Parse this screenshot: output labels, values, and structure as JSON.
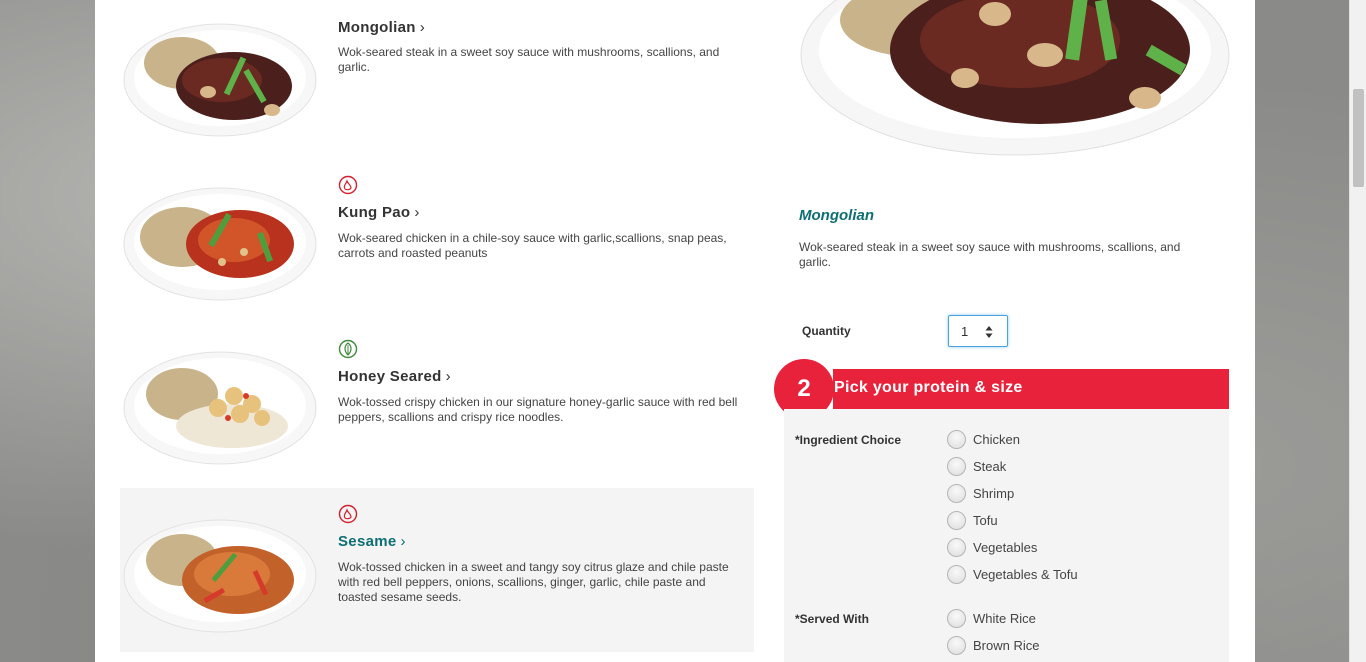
{
  "menu_items": [
    {
      "name": "Mongolian",
      "description": "Wok-seared steak in a sweet soy sauce with mushrooms, scallions, and garlic.",
      "badge": null,
      "selected": false
    },
    {
      "name": "Kung Pao",
      "description": "Wok-seared chicken in a chile-soy sauce with garlic,scallions, snap peas, carrots and roasted peanuts",
      "badge": "spicy-icon",
      "selected": false
    },
    {
      "name": "Honey Seared",
      "description": "Wok-tossed crispy chicken in our signature honey-garlic sauce with red bell peppers, scallions and crispy rice noodles.",
      "badge": "vegetarian-icon",
      "selected": false
    },
    {
      "name": "Sesame",
      "description": "Wok-tossed chicken in a sweet and tangy soy citrus glaze and chile paste with red bell peppers, onions, scallions, ginger, garlic, chile paste and toasted sesame seeds.",
      "badge": "spicy-icon",
      "selected": true
    }
  ],
  "chevron": "›",
  "detail": {
    "title": "Mongolian",
    "description": "Wok-seared steak in a sweet soy sauce with mushrooms, scallions, and garlic.",
    "quantity_label": "Quantity",
    "quantity_value": "1"
  },
  "step": {
    "number": "2",
    "title": "Pick your protein & size"
  },
  "ingredient_choice": {
    "label": "*Ingredient Choice",
    "options": [
      "Chicken",
      "Steak",
      "Shrimp",
      "Tofu",
      "Vegetables",
      "Vegetables & Tofu"
    ]
  },
  "served_with": {
    "label": "*Served With",
    "options": [
      "White Rice",
      "Brown Rice"
    ]
  },
  "colors": {
    "accent_red": "#e8223a",
    "teal": "#0d6e74",
    "spicy_icon": "#d3202f",
    "veg_icon": "#3f8a3c"
  }
}
